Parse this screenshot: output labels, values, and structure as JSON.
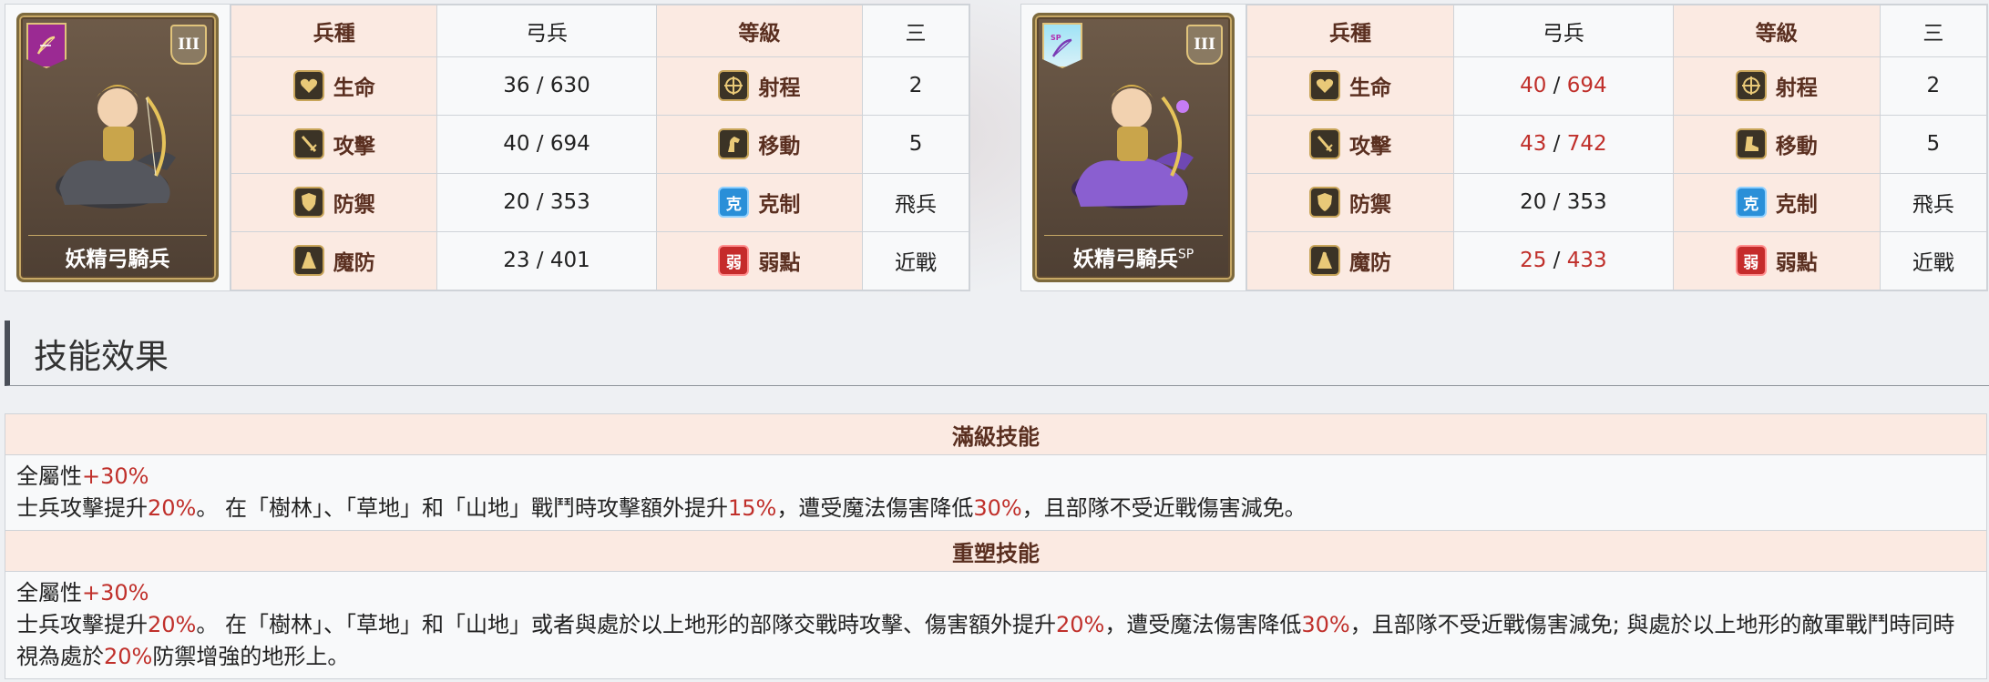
{
  "units": [
    {
      "name": "妖精弓騎兵",
      "name_sup": "",
      "sp": false,
      "rank_badge": "III",
      "rows": [
        {
          "l1": "兵種",
          "v1": "弓兵",
          "l2": "等級",
          "v2": "三"
        },
        {
          "l1": "生命",
          "v1": "36 / 630",
          "l2": "射程",
          "v2": "2"
        },
        {
          "l1": "攻擊",
          "v1": "40 / 694",
          "l2": "移動",
          "v2": "5"
        },
        {
          "l1": "防禦",
          "v1": "20 / 353",
          "l2": "克制",
          "v2": "飛兵"
        },
        {
          "l1": "魔防",
          "v1": "23 / 401",
          "l2": "弱點",
          "v2": "近戰"
        }
      ]
    },
    {
      "name": "妖精弓騎兵",
      "name_sup": "SP",
      "sp": true,
      "rank_badge": "III",
      "badge_text": "SP",
      "rows": [
        {
          "l1": "兵種",
          "v1": "弓兵",
          "l2": "等級",
          "v2": "三"
        },
        {
          "l1": "生命",
          "v1a": "40",
          "v1b": "694",
          "l2": "射程",
          "v2": "2"
        },
        {
          "l1": "攻擊",
          "v1a": "43",
          "v1b": "742",
          "l2": "移動",
          "v2": "5"
        },
        {
          "l1": "防禦",
          "v1": "20 / 353",
          "l2": "克制",
          "v2": "飛兵"
        },
        {
          "l1": "魔防",
          "v1a": "25",
          "v1b": "433",
          "l2": "弱點",
          "v2": "近戰"
        }
      ]
    }
  ],
  "icons": {
    "hp": "heart-icon",
    "atk": "sword-icon",
    "def": "shield-icon",
    "mdef": "cloak-icon",
    "range": "crosshair-icon",
    "move": "horse-icon",
    "counter": "克",
    "weak": "弱"
  },
  "section_title": "技能效果",
  "skills": [
    {
      "header": "滿級技能",
      "line1_a": "全屬性",
      "line1_b": "+30%",
      "line2": [
        {
          "t": "士兵攻擊提升"
        },
        {
          "t": "20%",
          "r": true
        },
        {
          "t": "。 在「樹林」、「草地」和「山地」戰鬥時攻擊額外提升"
        },
        {
          "t": "15%",
          "r": true
        },
        {
          "t": "，遭受魔法傷害降低"
        },
        {
          "t": "30%",
          "r": true
        },
        {
          "t": "，且部隊不受近戰傷害減免。"
        }
      ]
    },
    {
      "header": "重塑技能",
      "line1_a": "全屬性",
      "line1_b": "+30%",
      "line2": [
        {
          "t": "士兵攻擊提升"
        },
        {
          "t": "20%",
          "r": true
        },
        {
          "t": "。 在「樹林」、「草地」和「山地」或者與處於以上地形的部隊交戰時攻擊、傷害額外提升"
        },
        {
          "t": "20%",
          "r": true
        },
        {
          "t": "，遭受魔法傷害降低"
        },
        {
          "t": "30%",
          "r": true
        },
        {
          "t": "，且部隊不受近戰傷害減免; 與處於以上地形的敵軍戰鬥時同時視為處於"
        },
        {
          "t": "20%",
          "r": true
        },
        {
          "t": "防禦增強的地形上。"
        }
      ]
    }
  ],
  "colors": {
    "header_bg": "#fbeae2",
    "accent_red": "#c0302b"
  }
}
